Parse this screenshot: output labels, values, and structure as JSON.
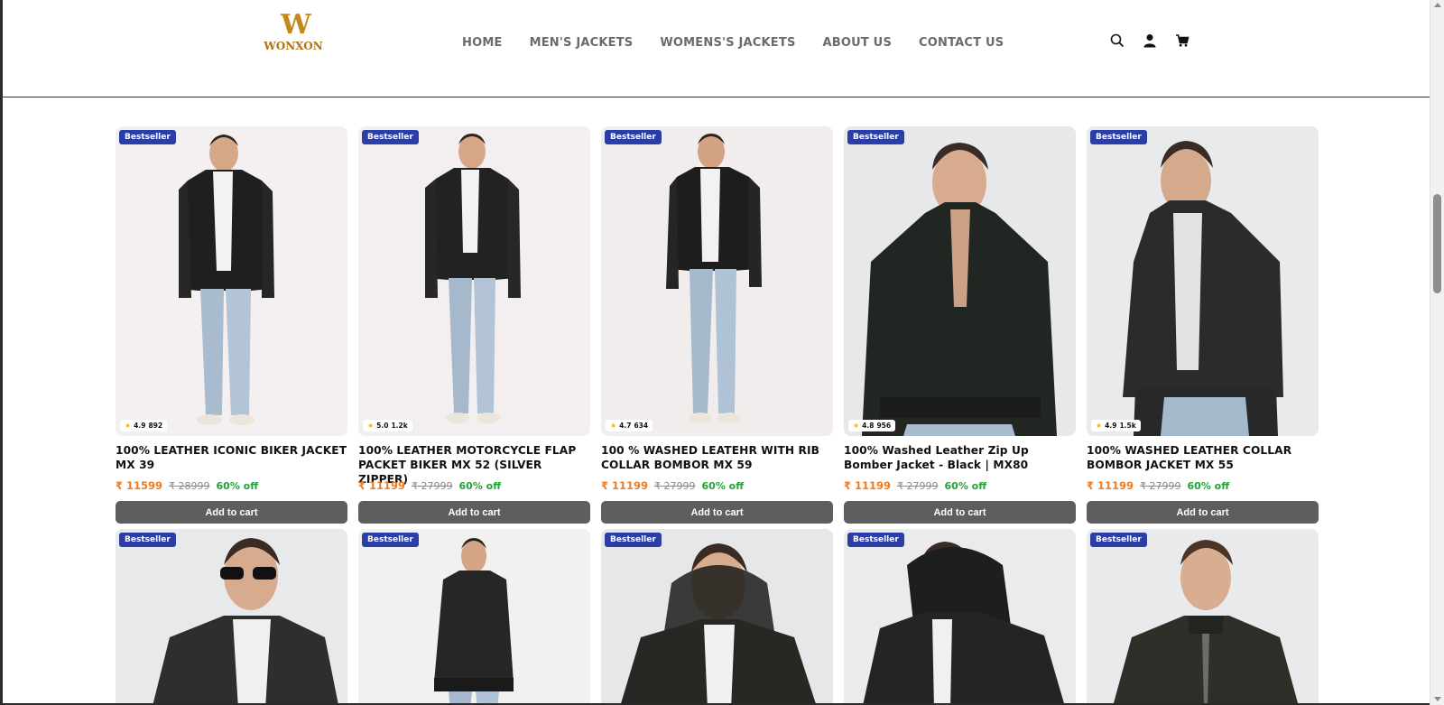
{
  "header": {
    "logo": {
      "mark": "W",
      "text": "WONXON"
    },
    "nav": [
      "HOME",
      "MEN'S JACKETS",
      "WOMENS'S JACKETS",
      "ABOUT US",
      "CONTACT US"
    ],
    "icons": [
      "search-icon",
      "user-icon",
      "cart-icon"
    ]
  },
  "products": [
    {
      "badge": "Bestseller",
      "rating": "4.9",
      "reviews": "892",
      "title": "100% LEATHER ICONIC BIKER JACKET MX 39",
      "price": "₹ 11599",
      "mrp": "₹ 28999",
      "off": "60% off",
      "button": "Add to cart"
    },
    {
      "badge": "Bestseller",
      "rating": "5.0",
      "reviews": "1.2k",
      "title": "100% LEATHER MOTORCYCLE FLAP PACKET BIKER MX 52 (SILVER ZIPPER)",
      "price": "₹ 11199",
      "mrp": "₹ 27999",
      "off": "60% off",
      "button": "Add to cart"
    },
    {
      "badge": "Bestseller",
      "rating": "4.7",
      "reviews": "634",
      "title": "100 % WASHED LEATEHR WITH RIB COLLAR BOMBOR MX 59",
      "price": "₹ 11199",
      "mrp": "₹ 27999",
      "off": "60% off",
      "button": "Add to cart"
    },
    {
      "badge": "Bestseller",
      "rating": "4.8",
      "reviews": "956",
      "title": "100% Washed Leather Zip Up Bomber Jacket - Black | MX80",
      "price": "₹ 11199",
      "mrp": "₹ 27999",
      "off": "60% off",
      "button": "Add to cart"
    },
    {
      "badge": "Bestseller",
      "rating": "4.9",
      "reviews": "1.5k",
      "title": "100% WASHED LEATHER COLLAR BOMBOR JACKET MX 55",
      "price": "₹ 11199",
      "mrp": "₹ 27999",
      "off": "60% off",
      "button": "Add to cart"
    }
  ],
  "products_row2": [
    {
      "badge": "Bestseller"
    },
    {
      "badge": "Bestseller"
    },
    {
      "badge": "Bestseller"
    },
    {
      "badge": "Bestseller"
    },
    {
      "badge": "Bestseller"
    }
  ],
  "colors": {
    "badge": "#2b3ea8",
    "price": "#f07a1f",
    "discount": "#1ea534",
    "button": "#5e5e5e"
  }
}
